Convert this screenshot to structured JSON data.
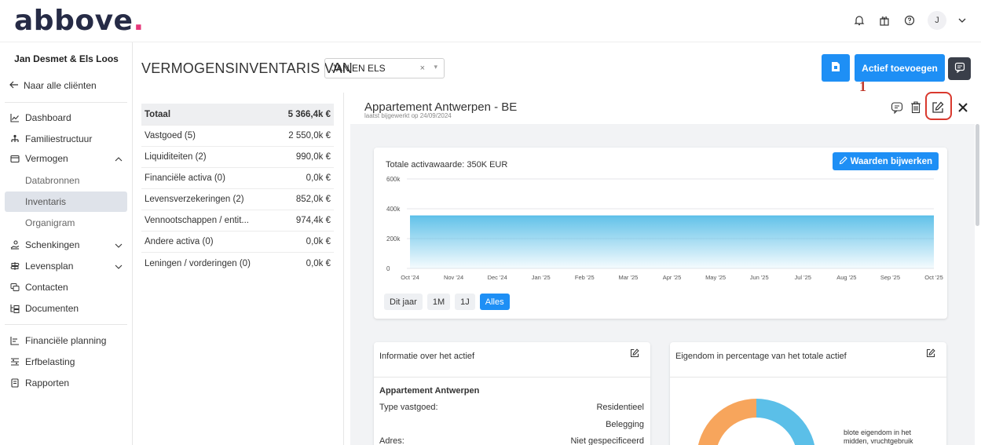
{
  "header": {
    "logo_main": "abbove",
    "logo_dot": ".",
    "user_initial": "J"
  },
  "sidebar": {
    "client_name": "Jan Desmet & Els Loos",
    "back_link": "Naar alle cliënten",
    "items": {
      "dashboard": "Dashboard",
      "familie": "Familiestructuur",
      "vermogen": "Vermogen",
      "databronnen": "Databronnen",
      "inventaris": "Inventaris",
      "organigram": "Organigram",
      "schenkingen": "Schenkingen",
      "levensplan": "Levensplan",
      "contacten": "Contacten",
      "documenten": "Documenten",
      "planning": "Financiële planning",
      "erfbelasting": "Erfbelasting",
      "rapporten": "Rapporten"
    }
  },
  "page": {
    "title": "VERMOGENSINVENTARIS VAN",
    "select_value": "JAN EN ELS",
    "select_clear": "×",
    "select_arrow": "▾",
    "add_button": "Actief toevoegen",
    "annotation_number": "1"
  },
  "summary": {
    "total_label": "Totaal",
    "total_value": "5 366,4k €",
    "rows": [
      {
        "label": "Vastgoed (5)",
        "value": "2 550,0k €"
      },
      {
        "label": "Liquiditeiten (2)",
        "value": "990,0k €"
      },
      {
        "label": "Financiële activa (0)",
        "value": "0,0k €"
      },
      {
        "label": "Levensverzekeringen (2)",
        "value": "852,0k €"
      },
      {
        "label": "Vennootschappen / entit...",
        "value": "974,4k €"
      },
      {
        "label": "Andere activa (0)",
        "value": "0,0k €"
      },
      {
        "label": "Leningen / vorderingen (0)",
        "value": "0,0k €"
      }
    ]
  },
  "detail": {
    "title": "Appartement Antwerpen - BE",
    "subtitle": "laatst bijgewerkt op 24/09/2024"
  },
  "chart_data": {
    "type": "area",
    "title": "Totale activawaarde: 350K EUR",
    "update_button": "Waarden bijwerken",
    "x": [
      "Oct '24",
      "Nov '24",
      "Dec '24",
      "Jan '25",
      "Feb '25",
      "Mar '25",
      "Apr '25",
      "May '25",
      "Jun '25",
      "Jul '25",
      "Aug '25",
      "Sep '25",
      "Oct '25"
    ],
    "series": [
      {
        "values": [
          350,
          350,
          350,
          350,
          350,
          350,
          350,
          350,
          350,
          350,
          350,
          350,
          350
        ]
      }
    ],
    "y_ticks": [
      0,
      200,
      400,
      600
    ],
    "y_tick_labels": [
      "0",
      "200k",
      "400k",
      "600k"
    ],
    "ylim": [
      0,
      600
    ],
    "grid": true,
    "line_color": "#5bbfe8",
    "range_buttons": [
      "Dit jaar",
      "1M",
      "1J",
      "Alles"
    ],
    "active_range": "Alles"
  },
  "info_card": {
    "title": "Informatie over het actief",
    "asset_name": "Appartement Antwerpen",
    "type_label": "Type vastgoed:",
    "type_value1": "Residentieel",
    "type_value2": "Belegging",
    "address_label": "Adres:",
    "address_value": "Niet gespecificeerd"
  },
  "ownership_card": {
    "title": "Eigendom in percentage van het totale actief",
    "legend": "blote eigendom in het midden, vruchtgebruik",
    "colors": {
      "left": "#f7a55c",
      "right": "#5bbfe8"
    }
  }
}
